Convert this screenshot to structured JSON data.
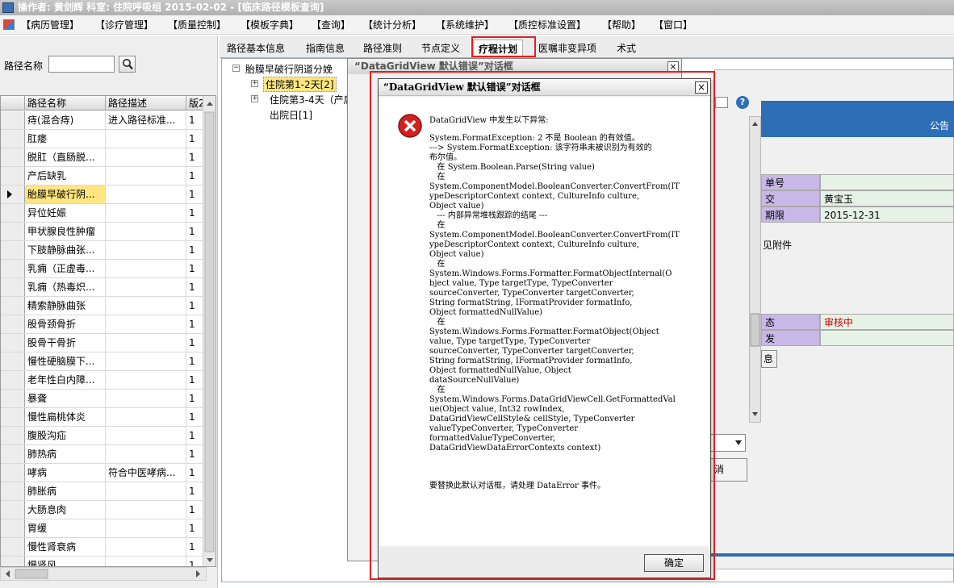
{
  "window": {
    "title": "操作者: 黄剑辉   科室: 住院呼吸组   2015-02-02 - [临床路径模板查询]"
  },
  "menu": [
    "【病历管理】",
    "【诊疗管理】",
    "【质量控制】",
    "【模板字典】",
    "【查询】",
    "【统计分析】",
    "【系统维护】",
    "【质控标准设置】",
    "【帮助】",
    "【窗口】"
  ],
  "left": {
    "search_label": "路径名称",
    "search_value": "",
    "grid_headers": [
      "路径名称",
      "路径描述",
      "版2"
    ],
    "rows": [
      {
        "name": "痔(混合痔)",
        "desc": "进入路径标准...",
        "ver": "1"
      },
      {
        "name": "肛瘘",
        "desc": "",
        "ver": "1"
      },
      {
        "name": "脱肛（直肠脱...",
        "desc": "",
        "ver": "1"
      },
      {
        "name": "产后缺乳",
        "desc": "",
        "ver": "1"
      },
      {
        "name": "胎膜早破行阴...",
        "desc": "",
        "ver": "1"
      },
      {
        "name": "异位妊娠",
        "desc": "",
        "ver": "1"
      },
      {
        "name": "甲状腺良性肿瘤",
        "desc": "",
        "ver": "1"
      },
      {
        "name": "下肢静脉曲张...",
        "desc": "",
        "ver": "1"
      },
      {
        "name": "乳痈（正虚毒...",
        "desc": "",
        "ver": "1"
      },
      {
        "name": "乳痈（热毒炽...",
        "desc": "",
        "ver": "1"
      },
      {
        "name": "精索静脉曲张",
        "desc": "",
        "ver": "1"
      },
      {
        "name": "股骨颈骨折",
        "desc": "",
        "ver": "1"
      },
      {
        "name": "股骨干骨折",
        "desc": "",
        "ver": "1"
      },
      {
        "name": "慢性硬脑膜下...",
        "desc": "",
        "ver": "1"
      },
      {
        "name": "老年性白内障...",
        "desc": "",
        "ver": "1"
      },
      {
        "name": "暴聋",
        "desc": "",
        "ver": "1"
      },
      {
        "name": "慢性扁桃体炎",
        "desc": "",
        "ver": "1"
      },
      {
        "name": "腹股沟疝",
        "desc": "",
        "ver": "1"
      },
      {
        "name": "肺热病",
        "desc": "",
        "ver": "1"
      },
      {
        "name": "哮病",
        "desc": "符合中医哮病...",
        "ver": "1"
      },
      {
        "name": "肺胀病",
        "desc": "",
        "ver": "1"
      },
      {
        "name": "大肠息肉",
        "desc": "",
        "ver": "1"
      },
      {
        "name": "胃缓",
        "desc": "",
        "ver": "1"
      },
      {
        "name": "慢性肾衰病",
        "desc": "",
        "ver": "1"
      },
      {
        "name": "慢肾风",
        "desc": "",
        "ver": "1"
      }
    ],
    "selected_index": 4
  },
  "tabs": [
    "路径基本信息",
    "指南信息",
    "路径准则",
    "节点定义",
    "疗程计划",
    "医嘱非变异项",
    "术式"
  ],
  "active_tab": "疗程计划",
  "tree": {
    "root": "胎膜早破行阴道分娩",
    "children": [
      "住院第1-2天[2]",
      "住院第3-4天（产后",
      "出院日[1]"
    ]
  },
  "bg_window_title": "“DataGridView 默认错误”对话框",
  "form": {
    "notice": "公告",
    "rows": [
      {
        "label": "单号",
        "value": ""
      },
      {
        "label": "交",
        "value": "黄宝玉"
      },
      {
        "label": "期限",
        "value": "2015-12-31"
      }
    ],
    "attach": "见附件",
    "status_rows": [
      {
        "label": "态",
        "value": "审核中"
      },
      {
        "label": "发",
        "value": ""
      }
    ],
    "small_btn": "息",
    "cancel_partial": "消",
    "status_color": "#cc0000"
  },
  "dialog": {
    "title": "“DataGridView 默认错误”对话框",
    "intro": "DataGridView 中发生以下异常:",
    "trace": "System.FormatException: 2 不是 Boolean 的有效值。\n---> System.FormatException: 该字符串未被识别为有效的\n布尔值。\n   在 System.Boolean.Parse(String value)\n   在\nSystem.ComponentModel.BooleanConverter.ConvertFrom(IT\nypeDescriptorContext context, CultureInfo culture,\nObject value)\n   --- 内部异常堆栈跟踪的结尾 ---\n   在\nSystem.ComponentModel.BooleanConverter.ConvertFrom(IT\nypeDescriptorContext context, CultureInfo culture,\nObject value)\n   在\nSystem.Windows.Forms.Formatter.FormatObjectInternal(O\nbject value, Type targetType, TypeConverter\nsourceConverter, TypeConverter targetConverter,\nString formatString, IFormatProvider formatInfo,\nObject formattedNullValue)\n   在\nSystem.Windows.Forms.Formatter.FormatObject(Object\nvalue, Type targetType, TypeConverter\nsourceConverter, TypeConverter targetConverter,\nString formatString, IFormatProvider formatInfo,\nObject formattedNullValue, Object\ndataSourceNullValue)\n   在\nSystem.Windows.Forms.DataGridViewCell.GetFormattedVal\nue(Object value, Int32 rowIndex,\nDataGridViewCellStyle& cellStyle, TypeConverter\nvalueTypeConverter, TypeConverter\nformattedValueTypeConverter,\nDataGridViewDataErrorContexts context)",
    "footer_text": "要替换此默认对话框，请处理 DataError 事件。",
    "ok": "确定",
    "close": "×"
  },
  "colors": {
    "highlight": "#e02020",
    "accent": "#2c6fb6",
    "selected_row": "#ffe680"
  }
}
